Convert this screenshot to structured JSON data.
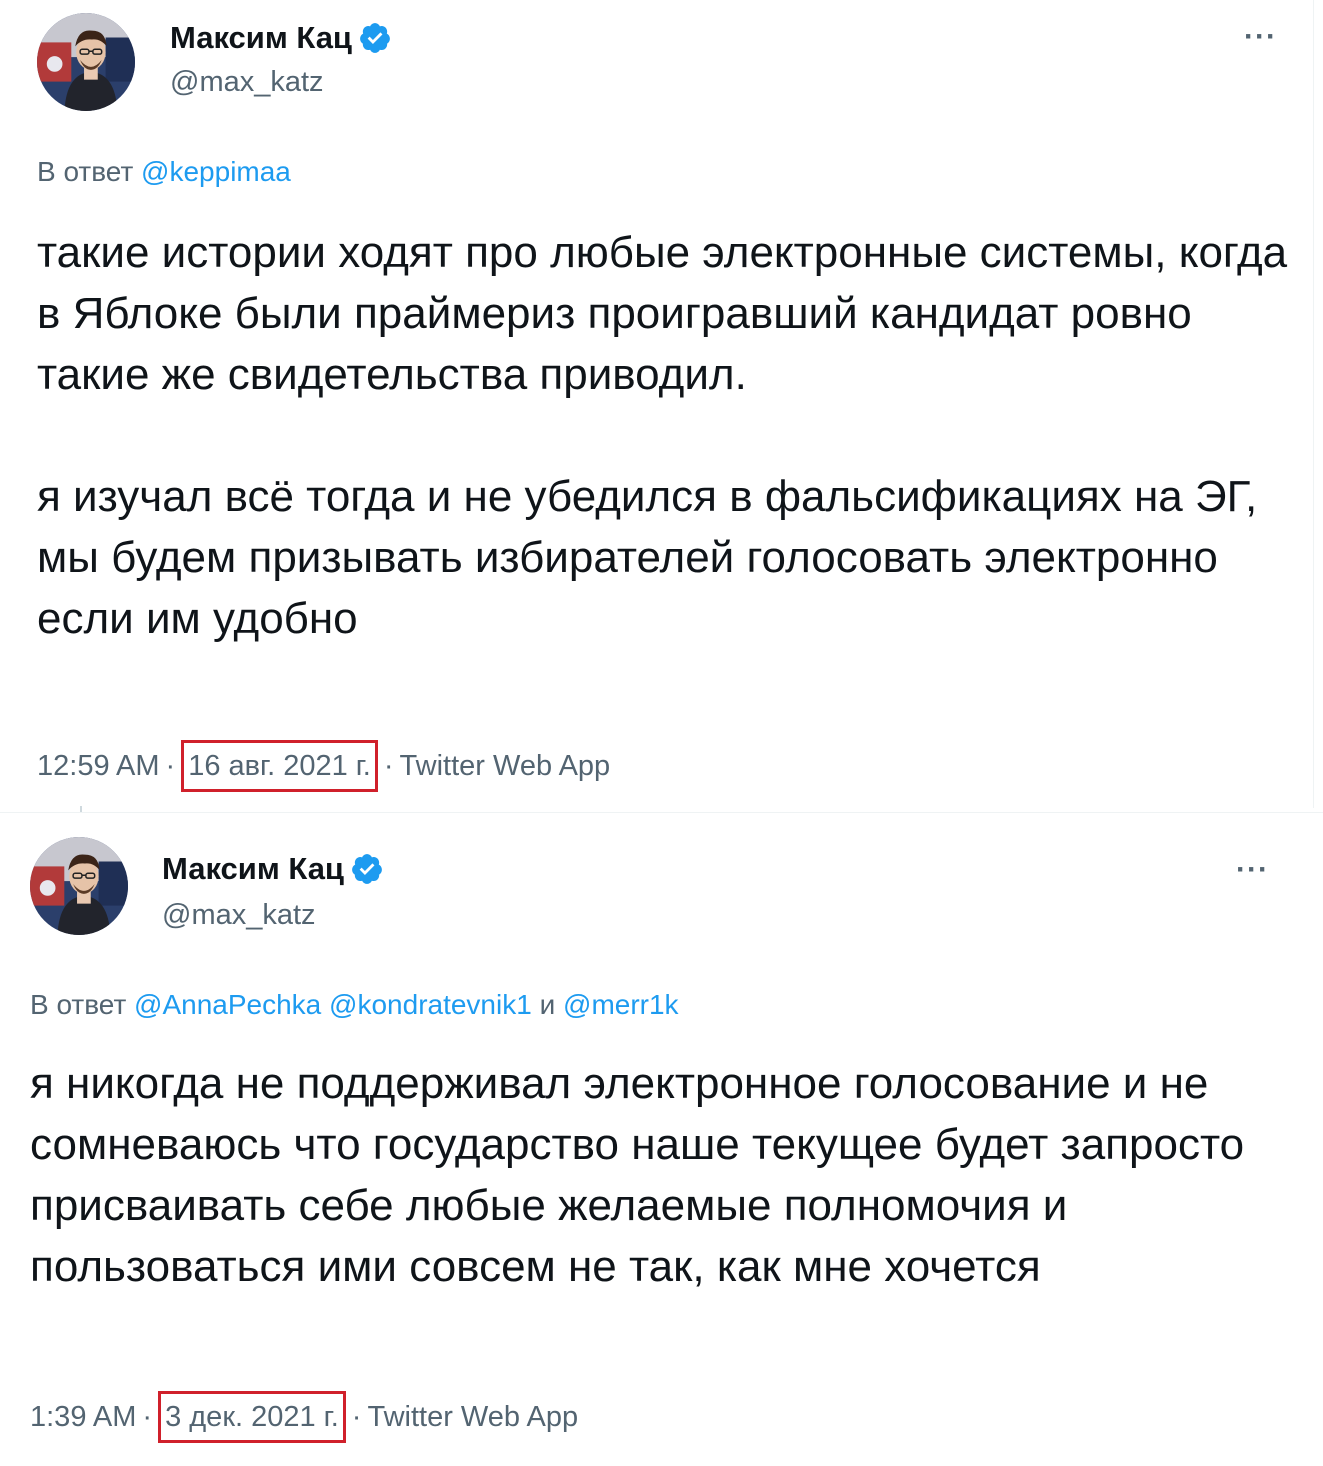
{
  "tweets": [
    {
      "display_name": "Максим Кац",
      "handle": "@max_katz",
      "more": "···",
      "reply_prefix": "В ответ",
      "mentions": [
        "@keppimaa"
      ],
      "body": "такие истории ходят про любые электронные системы, когда в Яблоке были праймериз проигравший кандидат ровно такие же свидетельства приводил.\n\nя изучал всё тогда и не убедился в фальсификациях на ЭГ, мы будем призывать избирателей голосовать электронно если им удобно",
      "time": "12:59 AM",
      "date": "16 авг. 2021 г.",
      "source": "Twitter Web App",
      "separator": "·"
    },
    {
      "display_name": "Максим Кац",
      "handle": "@max_katz",
      "more": "···",
      "reply_prefix": "В ответ",
      "mentions": [
        "@AnnaPechka",
        "@kondratevnik1"
      ],
      "mention_joiner": "и",
      "last_mention": "@merr1k",
      "body": "я никогда не поддерживал электронное голосование и не сомневаюсь что государство наше текущее будет запросто присваивать себе любые желаемые полномочия и пользоваться ими совсем не так, как мне хочется",
      "time": "1:39 AM",
      "date": "3 дек. 2021 г.",
      "source": "Twitter Web App",
      "separator": "·"
    }
  ],
  "colors": {
    "link": "#1d9bf0",
    "secondary_text": "#536471",
    "primary_text": "#0f1419",
    "highlight_box": "#d0202b",
    "verified_badge": "#1d9bf0"
  },
  "icons": {
    "verified": "verified-badge-icon",
    "more": "more-horizontal-icon"
  }
}
